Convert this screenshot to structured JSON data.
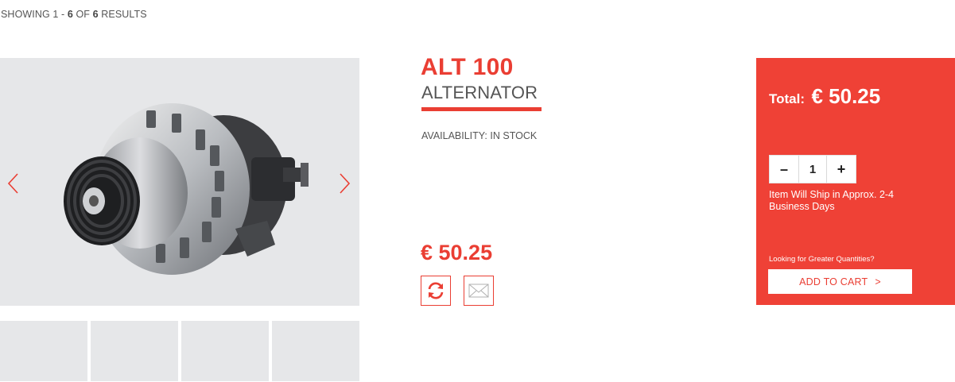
{
  "results": {
    "prefix": "SHOWING 1 - ",
    "range_end": "6",
    "of": " OF ",
    "total": "6",
    "suffix": " RESULTS"
  },
  "gallery": {
    "prev_icon": "chevron-left-icon",
    "next_icon": "chevron-right-icon",
    "thumbnail_count": 4
  },
  "product": {
    "code": "ALT 100",
    "name": "ALTERNATOR",
    "availability": "AVAILABILITY: IN STOCK",
    "price": "€ 50.25",
    "actions": [
      "refresh-icon",
      "envelope-icon"
    ]
  },
  "cart": {
    "total_label": "Total:",
    "total_amount": "€ 50.25",
    "quantity": "1",
    "minus_label": "–",
    "plus_label": "+",
    "ship_note": "Item Will Ship in Approx. 2-4 Business Days",
    "greater_quantities": "Looking for Greater Quantities?",
    "add_to_cart": "ADD TO CART",
    "add_to_cart_chevron": ">"
  },
  "colors": {
    "accent": "#ea3e33",
    "panel": "#ef4136",
    "gallery_bg": "#e6e7e9"
  }
}
